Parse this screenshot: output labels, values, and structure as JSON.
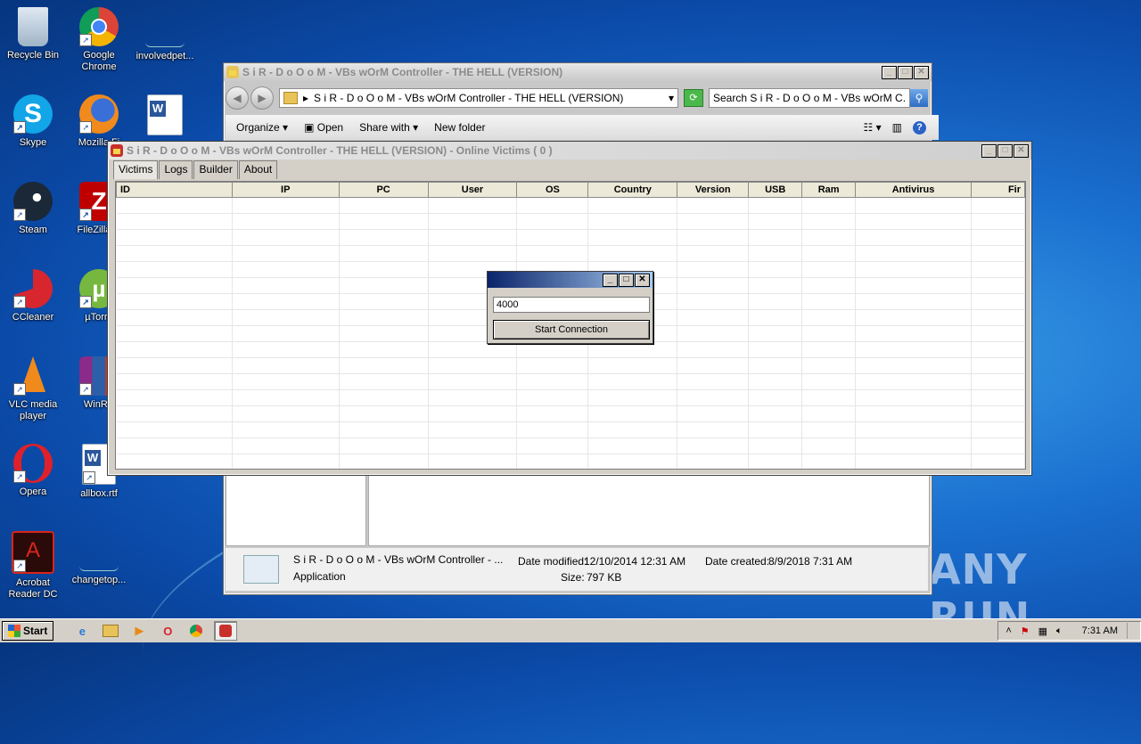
{
  "desktop": {
    "icons": [
      {
        "label": "Recycle Bin"
      },
      {
        "label": "Google Chrome"
      },
      {
        "label": "involvedpet..."
      },
      {
        "label": "Skype"
      },
      {
        "label": "Mozilla Fi"
      },
      {
        "label": ""
      },
      {
        "label": "Steam"
      },
      {
        "label": "FileZilla C"
      },
      {
        "label": "CCleaner"
      },
      {
        "label": "µTorre"
      },
      {
        "label": "VLC media player"
      },
      {
        "label": "WinRA"
      },
      {
        "label": "Opera"
      },
      {
        "label": "allbox.rtf"
      },
      {
        "label": "Acrobat Reader DC"
      },
      {
        "label": "changetop..."
      }
    ],
    "watermark": "ANY RUN"
  },
  "explorer": {
    "title": "S i R - D o O o M  - VBs wOrM Controller - THE HELL (VERSION)",
    "address": "S i R - D o O o M  - VBs wOrM Controller - THE HELL (VERSION)",
    "search_placeholder": "Search S i R - D o O o M  - VBs wOrM C...",
    "toolbar": {
      "organize": "Organize",
      "open": "Open",
      "share_with": "Share with",
      "new_folder": "New folder"
    },
    "details": {
      "name": "S i R - D o O o M  - VBs wOrM Controller - ...",
      "type": "Application",
      "date_modified_label": "Date modified:",
      "date_modified": "12/10/2014 12:31 AM",
      "date_created_label": "Date created:",
      "date_created": "8/9/2018 7:31 AM",
      "size_label": "Size:",
      "size": "797 KB"
    }
  },
  "app": {
    "title": "S i R - D o O o M  - VBs wOrM Controller - THE HELL (VERSION) - Online Victims ( 0 )",
    "tabs": [
      "Victims",
      "Logs",
      "Builder",
      "About"
    ],
    "active_tab": "Victims",
    "columns": [
      "ID",
      "IP",
      "PC",
      "User",
      "OS",
      "Country",
      "Version",
      "USB",
      "Ram",
      "Antivirus",
      "Fir"
    ],
    "rows": []
  },
  "dialog": {
    "port_value": "4000",
    "button_label": "Start Connection"
  },
  "taskbar": {
    "start_label": "Start",
    "clock": "7:31 AM"
  }
}
